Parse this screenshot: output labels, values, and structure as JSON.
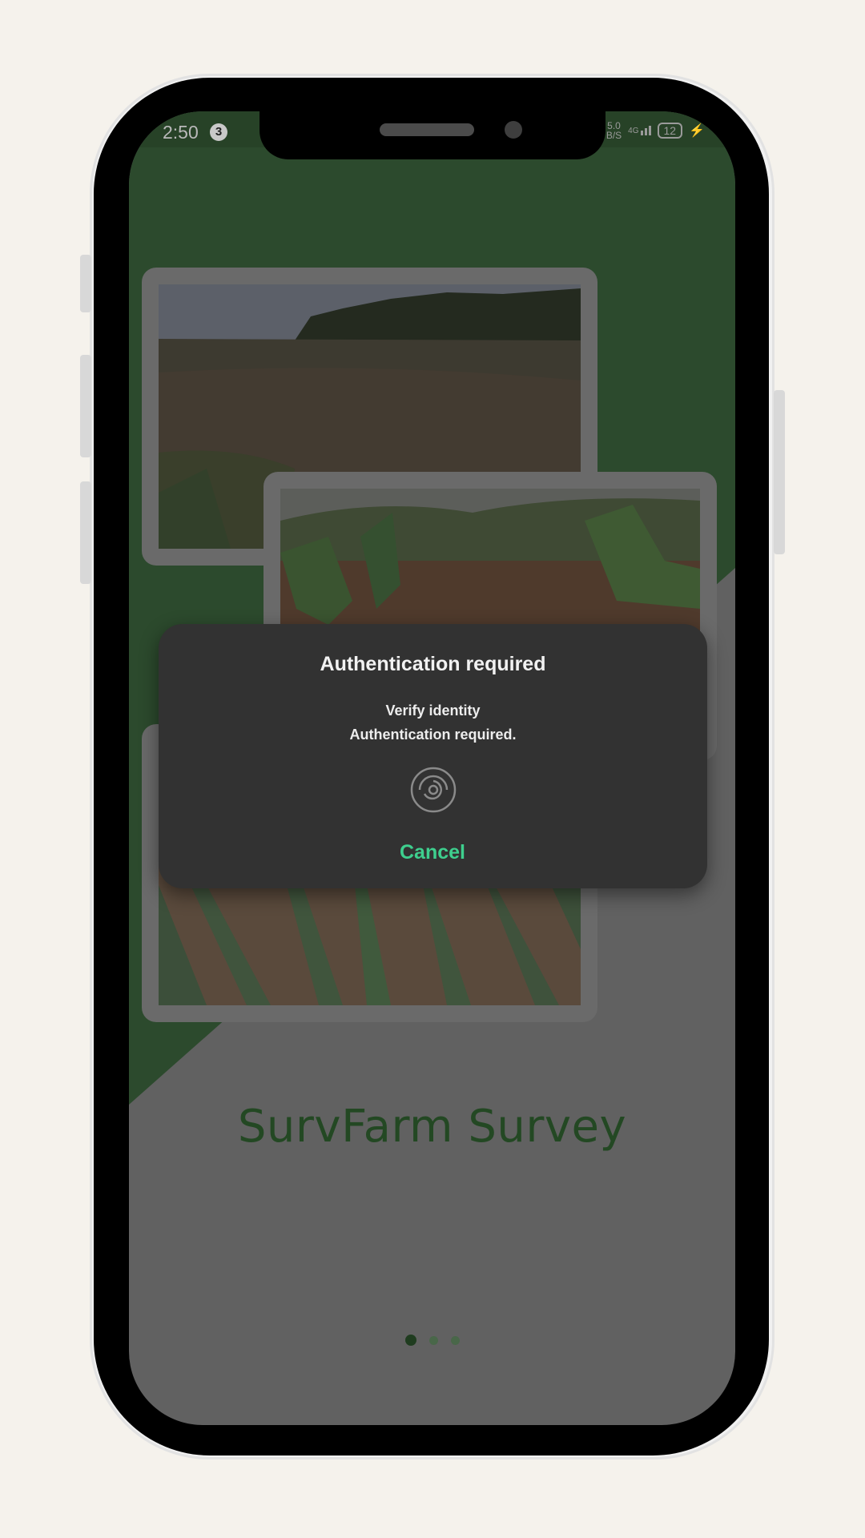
{
  "status_bar": {
    "time": "2:50",
    "notification_count": "3",
    "net_speed_value": "5.0",
    "net_speed_unit": "B/S",
    "network": "4G",
    "battery": "12"
  },
  "app": {
    "title": "SurvFarm Survey",
    "pager": {
      "total": 3,
      "active_index": 0
    }
  },
  "auth_dialog": {
    "title": "Authentication required",
    "subtitle": "Verify identity",
    "description": "Authentication required.",
    "cancel_label": "Cancel",
    "icon": "fingerprint-icon"
  },
  "colors": {
    "brand_green": "#2c4a2d",
    "accent": "#3ecf8e",
    "dialog_bg": "#323232"
  }
}
